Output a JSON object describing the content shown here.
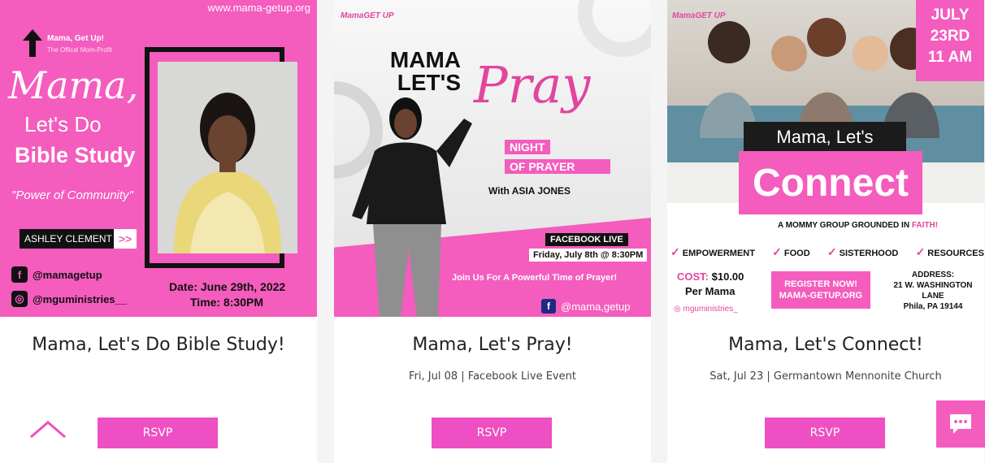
{
  "colors": {
    "accent": "#f45cbd",
    "button": "#ee4fc2",
    "dark": "#111111"
  },
  "events": [
    {
      "title": "Mama, Let's Do Bible Study!",
      "meta": "",
      "rsvp": "RSVP",
      "poster": {
        "url": "www.mama-getup.org",
        "logo_title": "Mama, Get Up!",
        "logo_subtitle": "The Offical Mom-Profit",
        "script": "Mama,",
        "lets_do": "Let's Do",
        "bible_study": "Bible Study",
        "tagline": "\"Power of Community\"",
        "speaker": "ASHLEY CLEMENT",
        "speaker_arrow": ">>",
        "facebook": "@mamagetup",
        "instagram": "@mguministries__",
        "date": "Date: June 29th, 2022",
        "time": "Time: 8:30PM"
      }
    },
    {
      "title": "Mama, Let's Pray!",
      "meta": "Fri, Jul 08  |  Facebook Live Event",
      "rsvp": "RSVP",
      "poster": {
        "logo": "MamaGET UP",
        "mama_lets": "MAMA LET'S",
        "pray": "Pray",
        "night": "NIGHT",
        "of_prayer": "OF PRAYER",
        "with": "With ASIA JONES",
        "fb_live": "FACEBOOK LIVE",
        "fb_date": "Friday, July 8th @ 8:30PM",
        "join": "Join Us For A Powerful Time of Prayer!",
        "fb_handle": "@mama,getup"
      }
    },
    {
      "title": "Mama, Let's Connect!",
      "meta": "Sat, Jul 23  |  Germantown Mennonite Church",
      "rsvp": "RSVP",
      "poster": {
        "logo": "MamaGET UP",
        "date_l1": "JULY",
        "date_l2": "23RD",
        "date_l3": "11 AM",
        "mama_lets": "Mama, Let's",
        "connect": "Connect",
        "tagline": "A MOMMY GROUP GROUNDED IN",
        "tagline_faith": "FAITH!",
        "items": [
          "EMPOWERMENT",
          "FOOD",
          "SISTERHOOD",
          "RESOURCES"
        ],
        "cost_label": "COST:",
        "cost_value": "$10.00",
        "per_mama": "Per Mama",
        "instagram": "mguministries_",
        "register_l1": "REGISTER NOW!",
        "register_l2": "MAMA-GETUP.ORG",
        "address_label": "ADDRESS:",
        "address_l1": "21 W. WASHINGTON",
        "address_l2": "LANE",
        "address_l3": "Phila, PA 19144"
      }
    }
  ],
  "icons": {
    "scroll_top": "chevron-up-icon",
    "chat": "chat-icon"
  }
}
